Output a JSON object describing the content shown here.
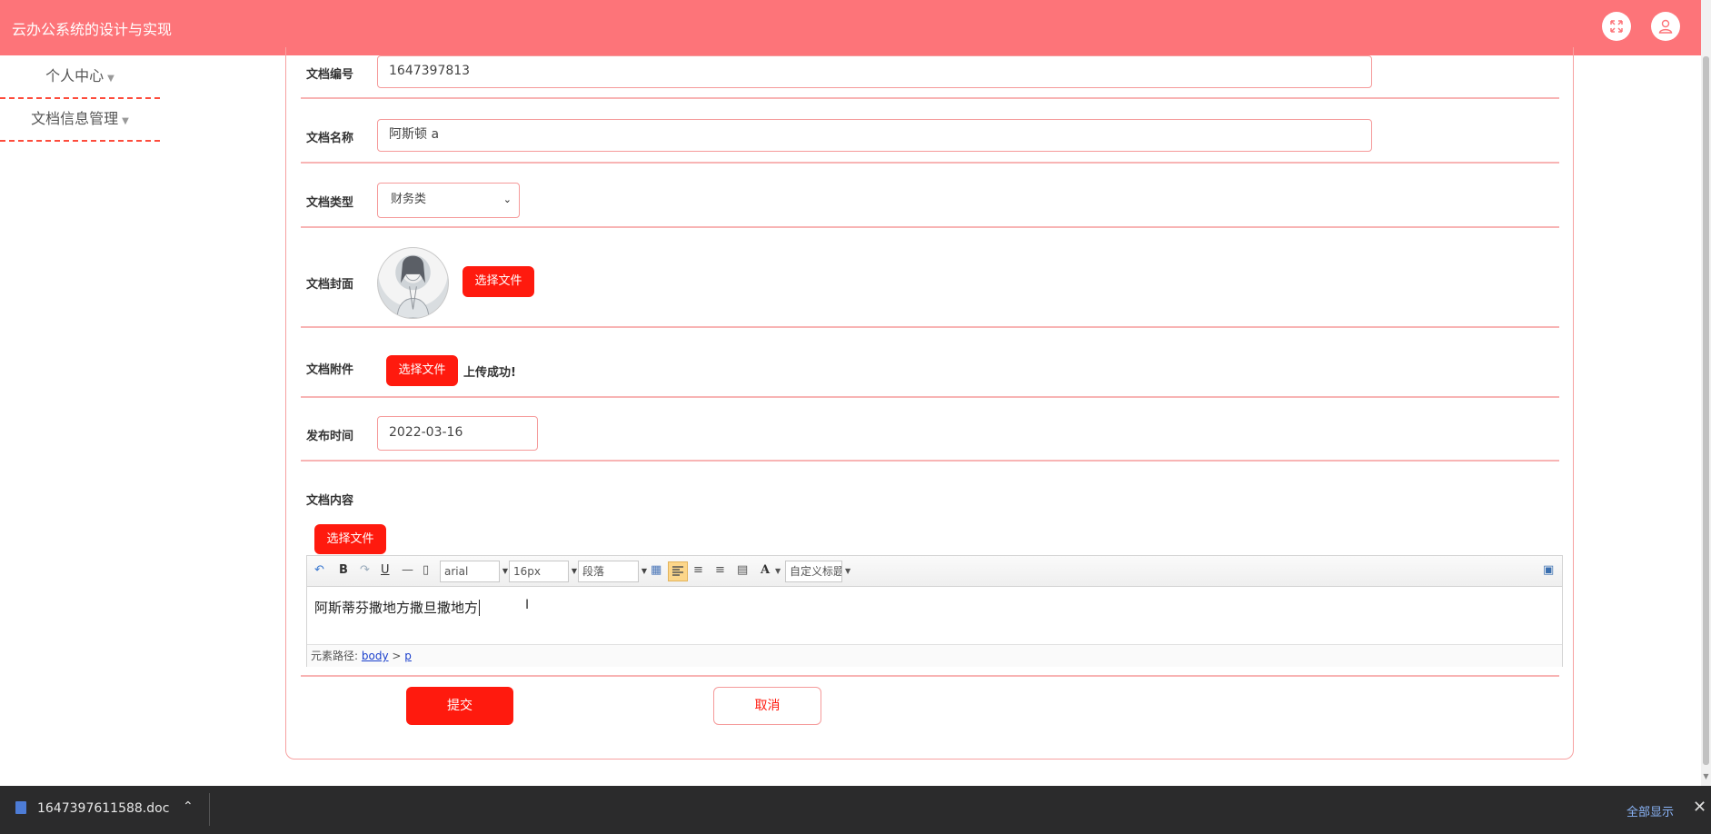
{
  "header": {
    "title": "云办公系统的设计与实现",
    "fullscreen_icon": "expand-icon",
    "user_icon": "user-icon",
    "color": "#fd7479"
  },
  "sidebar": {
    "items": [
      {
        "label": "个人中心"
      },
      {
        "label": "文档信息管理"
      }
    ]
  },
  "form": {
    "doc_no": {
      "label": "文档编号",
      "value": "1647397813"
    },
    "doc_name": {
      "label": "文档名称",
      "value": "阿斯顿 a"
    },
    "doc_type": {
      "label": "文档类型",
      "value": "财务类"
    },
    "doc_cover": {
      "label": "文档封面",
      "button": "选择文件"
    },
    "doc_attach": {
      "label": "文档附件",
      "button": "选择文件",
      "status": "上传成功!"
    },
    "publish_time": {
      "label": "发布时间",
      "value": "2022-03-16"
    },
    "doc_content": {
      "label": "文档内容",
      "button": "选择文件"
    },
    "submit_label": "提交",
    "cancel_label": "取消",
    "accent": "#ff1a0e"
  },
  "editor": {
    "font_family": "arial",
    "font_size": "16px",
    "paragraph": "段落",
    "custom_title": "自定义标题",
    "content": "阿斯蒂芬撒地方撒旦撒地方",
    "path_label": "元素路径:",
    "path_body": "body",
    "path_sep": ">",
    "path_p": "p"
  },
  "download_bar": {
    "filename": "1647397611588.doc",
    "show_all": "全部显示"
  }
}
